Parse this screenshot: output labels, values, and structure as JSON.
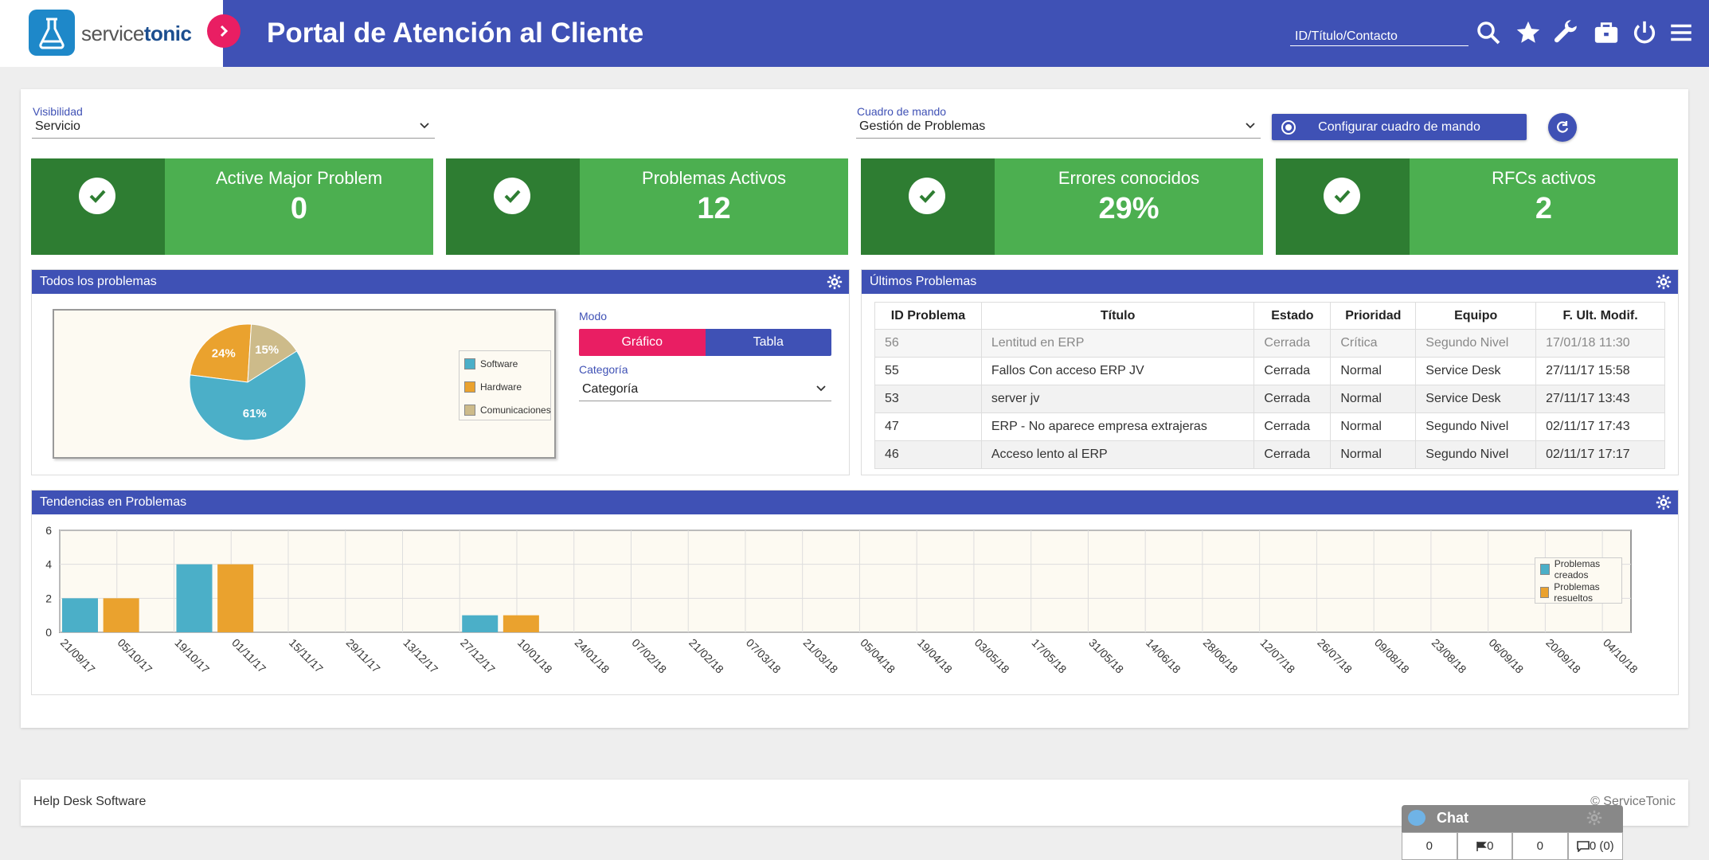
{
  "app": {
    "brand_plain": "service",
    "brand_bold": "tonic",
    "portal_title": "Portal de Atención al Cliente",
    "search_placeholder": "ID/Título/Contacto"
  },
  "filters": {
    "visibility_label": "Visibilidad",
    "visibility_value": "Servicio",
    "dashboard_label": "Cuadro de mando",
    "dashboard_value": "Gestión de Problemas",
    "configure_label": "Configurar cuadro de mando"
  },
  "kpis": [
    {
      "title": "Active Major Problem",
      "value": "0"
    },
    {
      "title": "Problemas Activos",
      "value": "12"
    },
    {
      "title": "Errores conocidos",
      "value": "29%"
    },
    {
      "title": "RFCs activos",
      "value": "2"
    }
  ],
  "all_problems": {
    "title": "Todos los problemas",
    "mode_label": "Modo",
    "mode_chart": "Gráfico",
    "mode_table": "Tabla",
    "category_label": "Categoría",
    "category_value": "Categoría"
  },
  "latest": {
    "title": "Últimos Problemas",
    "columns": [
      "ID Problema",
      "Título",
      "Estado",
      "Prioridad",
      "Equipo",
      "F. Ult. Modif."
    ],
    "rows": [
      [
        "56",
        "Lentitud en ERP",
        "Cerrada",
        "Crítica",
        "Segundo Nivel",
        "17/01/18 11:30"
      ],
      [
        "55",
        "Fallos Con acceso ERP JV",
        "Cerrada",
        "Normal",
        "Service Desk",
        "27/11/17 15:58"
      ],
      [
        "53",
        "server jv",
        "Cerrada",
        "Normal",
        "Service Desk",
        "27/11/17 13:43"
      ],
      [
        "47",
        "ERP - No aparece empresa extrajeras",
        "Cerrada",
        "Normal",
        "Segundo Nivel",
        "02/11/17 17:43"
      ],
      [
        "46",
        "Acceso lento al ERP",
        "Cerrada",
        "Normal",
        "Segundo Nivel",
        "02/11/17 17:17"
      ]
    ]
  },
  "trends": {
    "title": "Tendencias en Problemas"
  },
  "footer": {
    "left": "Help Desk Software",
    "right": "© ServiceTonic"
  },
  "chat": {
    "title": "Chat",
    "cells": [
      "0",
      "0",
      "0",
      "0 (0)"
    ]
  },
  "colors": {
    "header": "#3f51b5",
    "kpi_green": "#4caf50",
    "kpi_dark": "#2e7d32",
    "accent_pink": "#e91e63",
    "series_blue": "#4bafc8",
    "series_orange": "#eaa22e",
    "series_tan": "#cdbb8a"
  },
  "chart_data": [
    {
      "type": "pie",
      "categories": [
        "Software",
        "Hardware",
        "Comunicaciones"
      ],
      "values": [
        61,
        24,
        15
      ],
      "labels": [
        "61%",
        "24%",
        "15%"
      ]
    },
    {
      "type": "bar",
      "categories": [
        "21/09/17",
        "05/10/17",
        "19/10/17",
        "01/11/17",
        "15/11/17",
        "29/11/17",
        "13/12/17",
        "27/12/17",
        "10/01/18",
        "24/01/18",
        "07/02/18",
        "21/02/18",
        "07/03/18",
        "21/03/18",
        "05/04/18",
        "19/04/18",
        "03/05/18",
        "17/05/18",
        "31/05/18",
        "14/06/18",
        "28/06/18",
        "12/07/18",
        "26/07/18",
        "09/08/18",
        "23/08/18",
        "06/09/18",
        "20/09/18",
        "04/10/18"
      ],
      "series": [
        {
          "name": "Problemas creados",
          "values": [
            2,
            0,
            4,
            0,
            0,
            0,
            0,
            1,
            0,
            0,
            0,
            0,
            0,
            0,
            0,
            0,
            0,
            0,
            0,
            0,
            0,
            0,
            0,
            0,
            0,
            0,
            0,
            0
          ]
        },
        {
          "name": "Problemas resueltos",
          "values": [
            2,
            0,
            4,
            0,
            0,
            0,
            0,
            1,
            0,
            0,
            0,
            0,
            0,
            0,
            0,
            0,
            0,
            0,
            0,
            0,
            0,
            0,
            0,
            0,
            0,
            0,
            0,
            0
          ]
        }
      ],
      "yticks": [
        0,
        2,
        4,
        6
      ],
      "ylim": [
        0,
        6
      ],
      "grid": true,
      "legend": "right"
    }
  ]
}
